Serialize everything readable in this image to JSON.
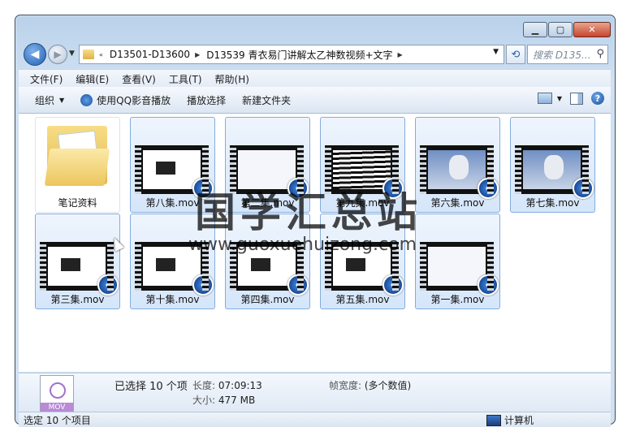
{
  "window": {
    "caption_buttons": [
      "▁",
      "▢",
      "✕"
    ]
  },
  "nav": {
    "breadcrumb": [
      "D13501-D13600",
      "D13539 青衣易门讲解太乙神数视频+文字"
    ],
    "search_placeholder": "搜索 D135..."
  },
  "menu": [
    "文件(F)",
    "编辑(E)",
    "查看(V)",
    "工具(T)",
    "帮助(H)"
  ],
  "toolbar": {
    "organize": "组织",
    "play_qq": "使用QQ影音播放",
    "play_selection": "播放选择",
    "new_folder": "新建文件夹"
  },
  "files": [
    {
      "name": "笔记资料",
      "type": "folder"
    },
    {
      "name": "第八集.mov",
      "type": "video",
      "thumb": "dark"
    },
    {
      "name": "第二集.mov",
      "type": "video",
      "thumb": "scroll"
    },
    {
      "name": "第九集.mov",
      "type": "video",
      "thumb": "lines"
    },
    {
      "name": "第六集.mov",
      "type": "video",
      "thumb": "sky"
    },
    {
      "name": "第七集.mov",
      "type": "video",
      "thumb": "sky"
    },
    {
      "name": "第三集.mov",
      "type": "video",
      "thumb": "dark"
    },
    {
      "name": "第十集.mov",
      "type": "video",
      "thumb": "dark"
    },
    {
      "name": "第四集.mov",
      "type": "video",
      "thumb": "dark"
    },
    {
      "name": "第五集.mov",
      "type": "video",
      "thumb": "dark"
    },
    {
      "name": "第一集.mov",
      "type": "video",
      "thumb": "scroll"
    }
  ],
  "details": {
    "icon_label": "MOV",
    "selected": "已选择 10 个项",
    "length_key": "长度:",
    "length_val": "07:09:13",
    "size_key": "大小:",
    "size_val": "477 MB",
    "frame_key": "帧宽度:",
    "frame_val": "(多个数值)"
  },
  "status": {
    "left": "选定 10 个项目",
    "right": "计算机"
  },
  "watermark": {
    "title": "国学汇总站",
    "url": "www.guoxuehuizong.com"
  }
}
